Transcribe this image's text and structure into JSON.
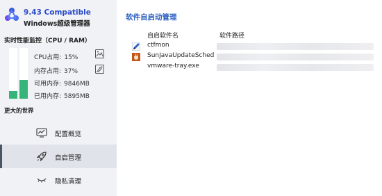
{
  "app": {
    "version": "9.43 Compatible",
    "name": "Windows超级管理器"
  },
  "monitor": {
    "title": "实时性能监控（CPU / RAM）",
    "cpu_fill": 0.15,
    "mem_fill": 0.37,
    "bar_color": "#36b47a",
    "stats": [
      {
        "label": "CPU占用:",
        "value": "15%"
      },
      {
        "label": "内存占用:",
        "value": "37%"
      },
      {
        "label": "可用内存:",
        "value": "9846MB"
      },
      {
        "label": "已用内存:",
        "value": "5895MB"
      }
    ]
  },
  "section_label": "更大的世界",
  "nav": [
    {
      "label": "配置概览",
      "icon": "chart-monitor-icon",
      "active": false
    },
    {
      "label": "自启管理",
      "icon": "rocket-icon",
      "active": true
    },
    {
      "label": "隐私清理",
      "icon": "eye-closed-icon",
      "active": false
    }
  ],
  "main": {
    "title": "软件自启动管理",
    "columns": [
      "自启软件名",
      "软件路径"
    ],
    "rows": [
      {
        "name": "ctfmon",
        "icon": "pen-app-icon"
      },
      {
        "name": "SunJavaUpdateSched",
        "icon": "java-app-icon"
      },
      {
        "name": "vmware-tray.exe",
        "icon": "blank-app-icon"
      }
    ]
  },
  "colors": {
    "accent": "#2f62c2",
    "sidebar_bg": "#f1f2f6",
    "active_bg": "#e1e3ea"
  }
}
